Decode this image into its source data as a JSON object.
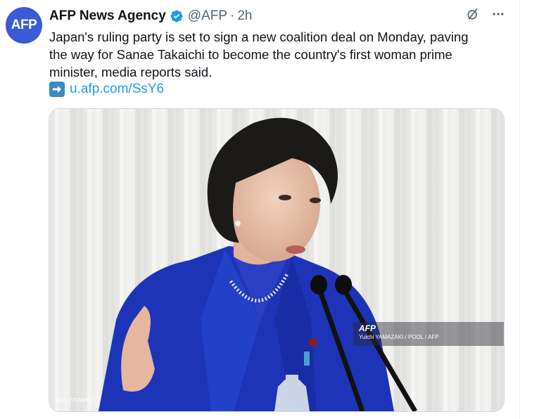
{
  "author": {
    "avatar_text": "AFP",
    "name": "AFP News Agency",
    "handle": "@AFP",
    "separator": "·",
    "time": "2h",
    "verified": true
  },
  "actions": [
    {
      "icon": "grok-icon"
    },
    {
      "icon": "more-icon"
    }
  ],
  "tweet": {
    "lines": [
      "Japan's ruling party is set to sign a new coalition deal on Monday, paving",
      "the way for Sanae Takaichi to become the country's first woman prime",
      "minister, media reports said."
    ],
    "link_icon": "right-arrow-icon",
    "link_text": "u.afp.com/SsY6"
  },
  "media": {
    "watermark": "AFP",
    "credit": "Yuichi YAMAZAKI / POOL / AFP",
    "photo_id": "000_77NW82Z"
  },
  "colors": {
    "accent": "#1d9bf0",
    "avatar_bg": "#3a5ad6",
    "jacket": "#1d34b8",
    "text_secondary": "#536471"
  }
}
